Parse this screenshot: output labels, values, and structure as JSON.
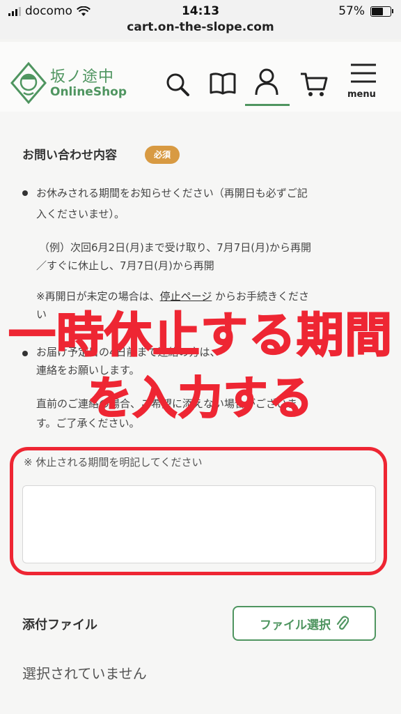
{
  "status_bar": {
    "carrier": "docomo",
    "time": "14:13",
    "battery": "57%",
    "battery_level": 0.57,
    "url": "cart.on-the-slope.com"
  },
  "header": {
    "logo_jp": "坂ノ途中",
    "logo_en": "OnlineShop",
    "menu_label": "menu",
    "icons": [
      "search-icon",
      "book-icon",
      "user-icon",
      "cart-icon",
      "hamburger-icon"
    ],
    "accent_color": "#4f9560"
  },
  "form": {
    "section_title": "お問い合わせ内容",
    "required_badge": "必須",
    "bullet1_line1": "お休みされる期間をお知らせください（再開日も必ずご記",
    "bullet1_line2": "入くださいませ）。",
    "example_line1": "（例）次回6月2日(月)まで受け取り、7月7日(月)から再開",
    "example_line2": "／すぐに休止し、7月7日(月)から再開",
    "note_prefix": "※再開日が未定の場合は、",
    "note_link": "停止ページ",
    "note_suffix": " からお手続きくださ",
    "note_line2": "い",
    "bullet2_line1": "お届け予定日の4日前まで連絡の方は、",
    "bullet2_line2": "連絡をお願いします。",
    "bullet2_line3": "直前のご連絡の場合、ご希望に添えない場合がございま",
    "bullet2_line4": "す。ご了承ください。",
    "field_note": "※ 休止される期間を明記してください",
    "textarea_value": "",
    "attach_label": "添付ファイル",
    "file_button": "ファイル選択",
    "no_file": "選択されていません"
  },
  "overlay": {
    "line1": "一時休止する期間",
    "line2": "を入力する",
    "color": "#ee2633"
  }
}
